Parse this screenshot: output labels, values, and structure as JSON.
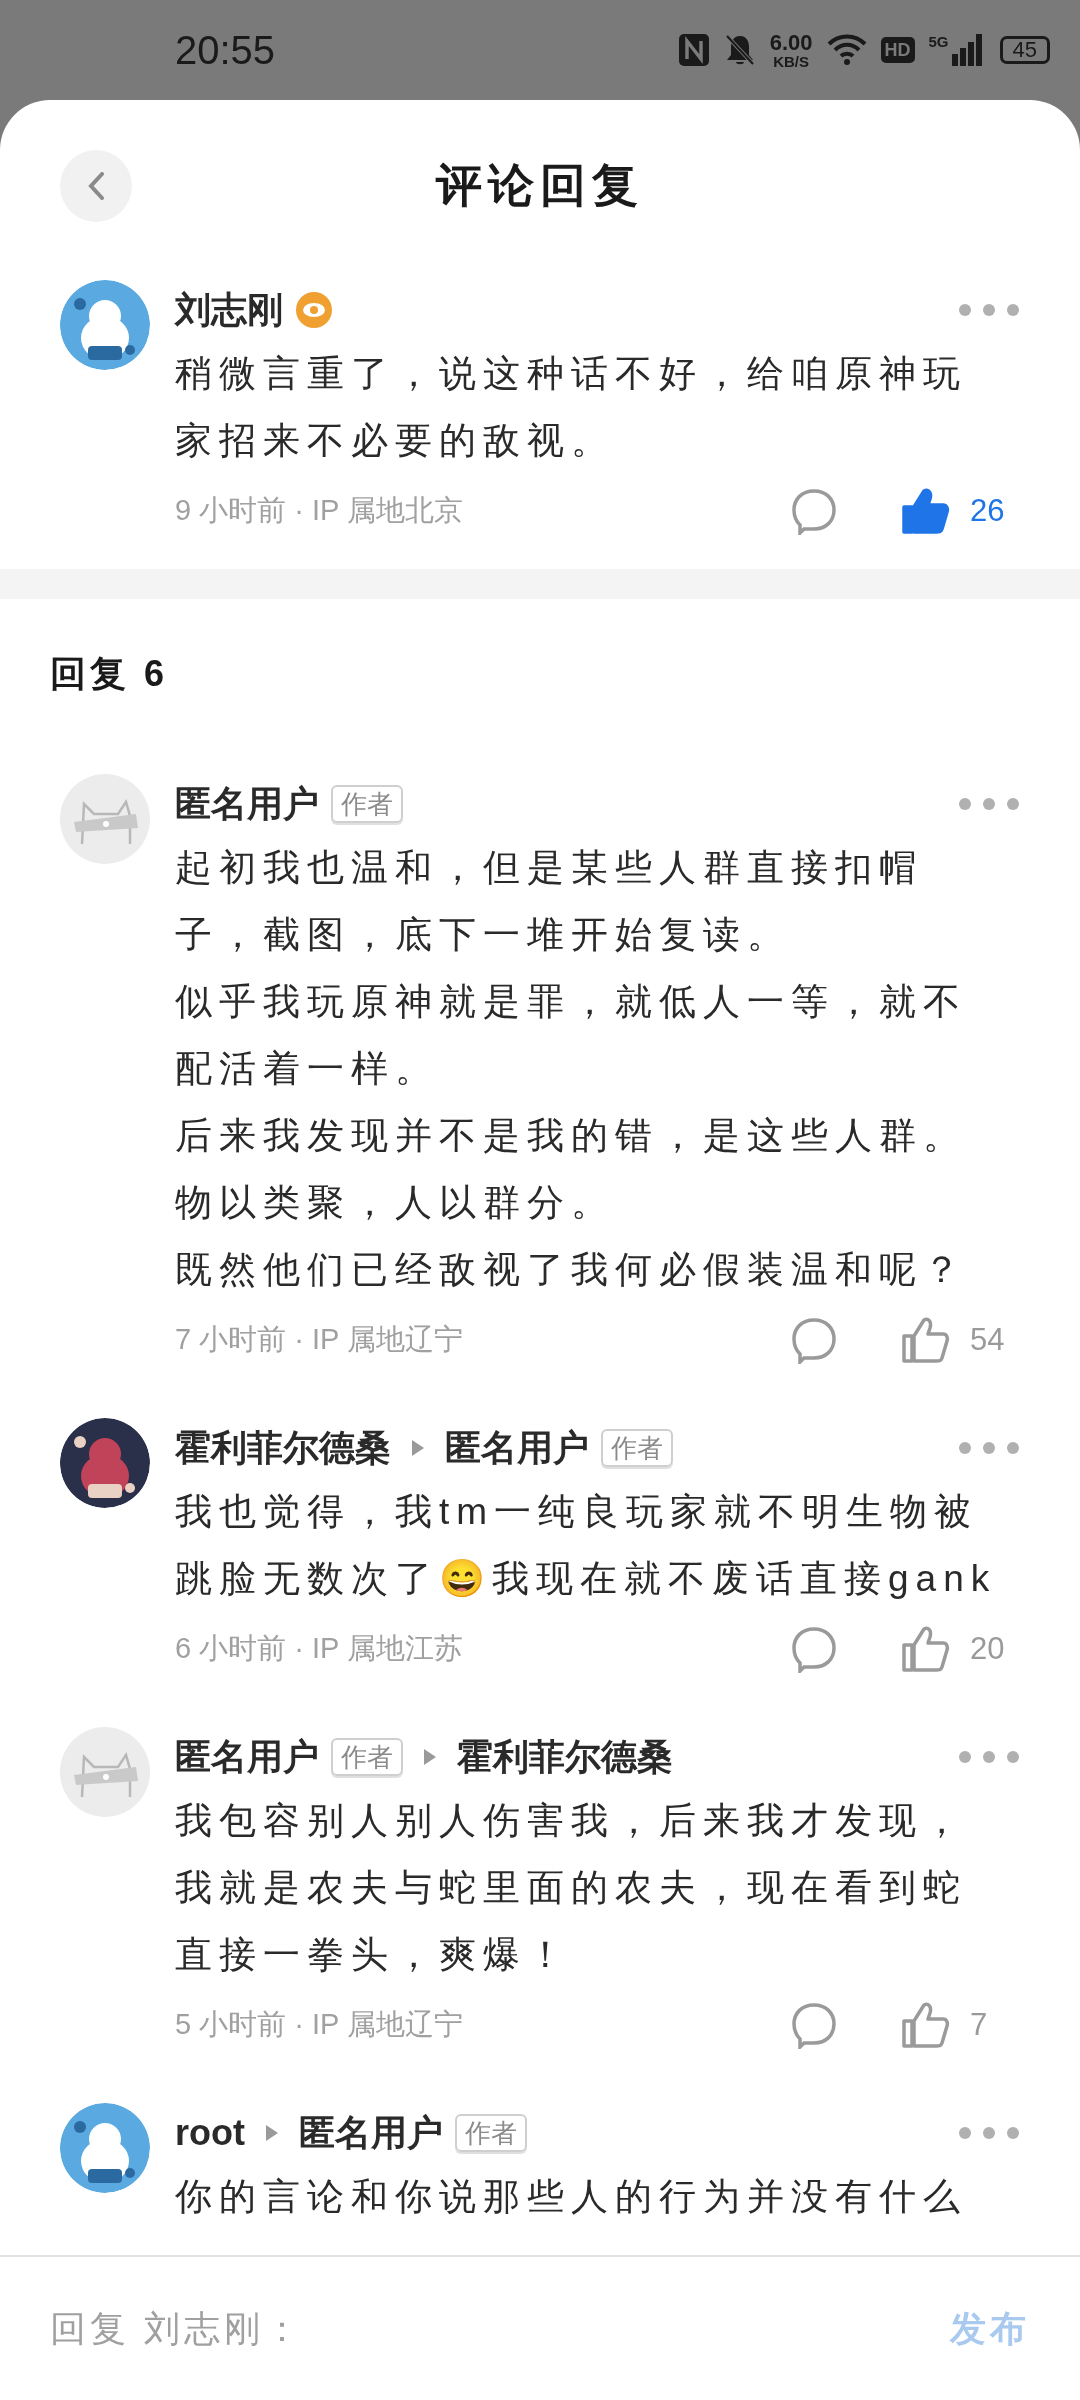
{
  "status_bar": {
    "time": "20:55",
    "speed_value": "6.00",
    "speed_unit": "KB/S",
    "hd": "HD",
    "network": "5G",
    "battery": "45"
  },
  "header": {
    "title": "评论回复"
  },
  "comment": {
    "name": "刘志刚",
    "paragraphs": [
      "稍微言重了，说这种话不好，给咱原神玩家招来不必要的敌视。"
    ],
    "meta": "9 小时前 · IP 属地北京",
    "likes": "26",
    "liked": true
  },
  "replies_heading": "回复 6",
  "replies": [
    {
      "name": "匿名用户",
      "name_badge": "作者",
      "avatar": {
        "kind": "default"
      },
      "paragraphs": [
        "起初我也温和，但是某些人群直接扣帽子，截图，底下一堆开始复读。",
        "似乎我玩原神就是罪，就低人一等，就不配活着一样。",
        "后来我发现并不是我的错，是这些人群。",
        "物以类聚，人以群分。",
        "既然他们已经敌视了我何必假装温和呢？"
      ],
      "meta": "7 小时前 · IP 属地辽宁",
      "likes": "54",
      "liked": false
    },
    {
      "name": "霍利菲尔德桑",
      "reply_to": "匿名用户",
      "reply_to_badge": "作者",
      "paragraphs": [
        "我也觉得，我tm一纯良玩家就不明生物被跳脸无数次了😄我现在就不废话直接gank"
      ],
      "meta": "6 小时前 · IP 属地江苏",
      "likes": "20",
      "liked": false
    },
    {
      "name": "匿名用户",
      "name_badge": "作者",
      "avatar": {
        "kind": "default"
      },
      "reply_to": "霍利菲尔德桑",
      "paragraphs": [
        "我包容别人别人伤害我，后来我才发现，我就是农夫与蛇里面的农夫，现在看到蛇直接一拳头，爽爆！"
      ],
      "meta": "5 小时前 · IP 属地辽宁",
      "likes": "7",
      "liked": false
    },
    {
      "name": "root",
      "reply_to": "匿名用户",
      "reply_to_badge": "作者",
      "paragraphs": [
        "你的言论和你说那些人的行为并没有什么"
      ]
    }
  ],
  "reply_bar": {
    "placeholder": "回复 刘志刚：",
    "send": "发布"
  }
}
